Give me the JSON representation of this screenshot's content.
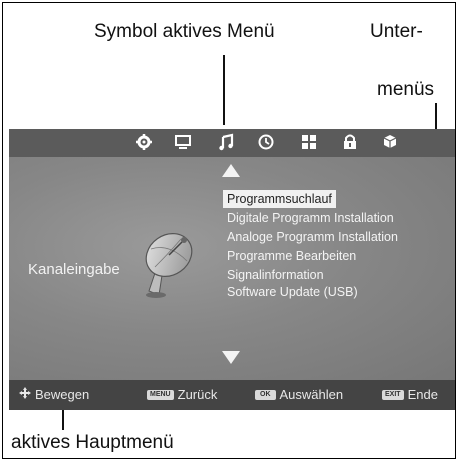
{
  "callouts": {
    "top_center": "Symbol aktives Menü",
    "top_right_line1": "Unter-",
    "top_right_line2": "menüs",
    "bottom": "aktives Hauptmenü"
  },
  "top_icons": [
    "gear-icon",
    "monitor-icon",
    "music-note-icon",
    "clock-icon",
    "grid-icon",
    "lock-icon",
    "cube-icon"
  ],
  "main_menu": {
    "active_label": "Kanaleingabe",
    "icon": "satellite-dish-icon"
  },
  "submenu": {
    "items": [
      "Programmsuchlauf",
      "Digitale Programm Installation",
      "Analoge Programm Installation",
      "Programme Bearbeiten",
      "Signalinformation",
      "Software Update (USB)"
    ],
    "selected_index": 0
  },
  "bottom_bar": {
    "move_label": "Bewegen",
    "menu_key": "MENU",
    "back_label": "Zurück",
    "ok_key": "OK",
    "select_label": "Auswählen",
    "exit_key": "EXIT",
    "end_label": "Ende"
  },
  "colors": {
    "top_bar": "#5b5b5b",
    "content_bg": "#7d7d7d",
    "bottom_bar": "#444444",
    "selection": "#f1f1f1"
  }
}
